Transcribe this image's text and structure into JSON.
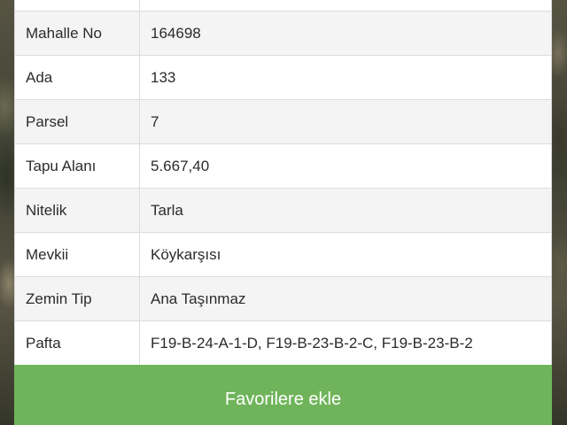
{
  "parcel_info": {
    "rows": [
      {
        "label": "",
        "value": ""
      },
      {
        "label": "Mahalle No",
        "value": "164698"
      },
      {
        "label": "Ada",
        "value": "133"
      },
      {
        "label": "Parsel",
        "value": "7"
      },
      {
        "label": "Tapu Alanı",
        "value": "5.667,40"
      },
      {
        "label": "Nitelik",
        "value": "Tarla"
      },
      {
        "label": "Mevkii",
        "value": "Köykarşısı"
      },
      {
        "label": "Zemin Tip",
        "value": "Ana Taşınmaz"
      },
      {
        "label": "Pafta",
        "value": "F19-B-24-A-1-D, F19-B-23-B-2-C, F19-B-23-B-2"
      }
    ]
  },
  "actions": {
    "favorite_label": "Favorilere ekle"
  },
  "colors": {
    "button_green": "#6fb45a",
    "row_alt": "#f4f4f4",
    "border": "#dcdcdc"
  }
}
